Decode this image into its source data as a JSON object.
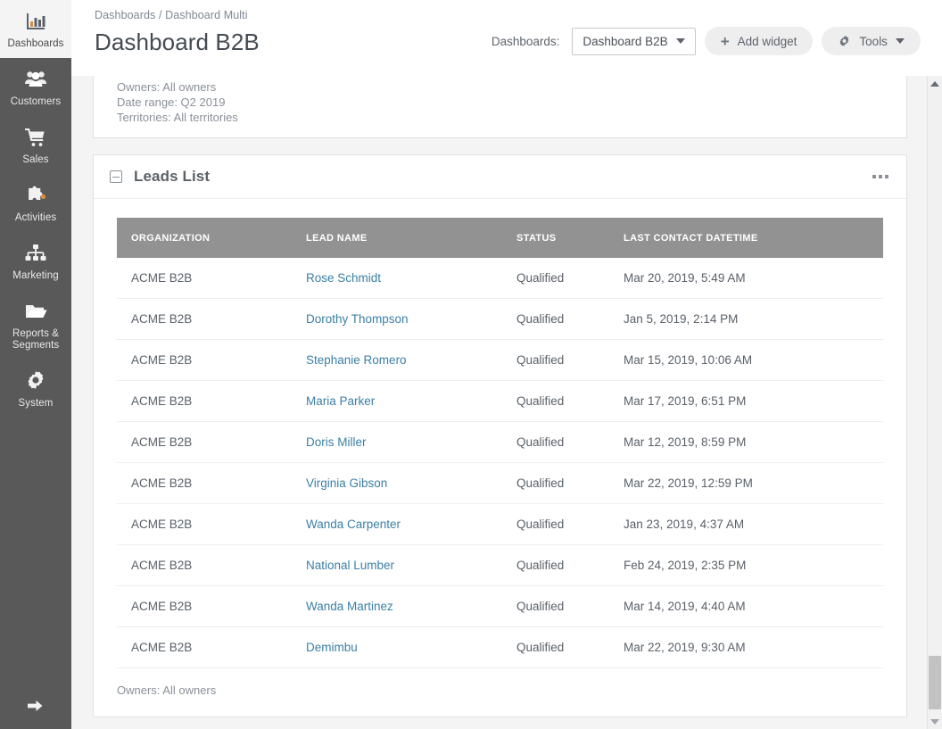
{
  "sidebar": {
    "items": [
      {
        "label": "Dashboards",
        "icon": "bar-chart-icon",
        "active": true
      },
      {
        "label": "Customers",
        "icon": "people-icon",
        "active": false
      },
      {
        "label": "Sales",
        "icon": "shopping-cart-icon",
        "active": false
      },
      {
        "label": "Activities",
        "icon": "puzzle-piece-icon",
        "active": false
      },
      {
        "label": "Marketing",
        "icon": "sitemap-icon",
        "active": false
      },
      {
        "label": "Reports &\nSegments",
        "icon": "folder-open-icon",
        "active": false
      },
      {
        "label": "System",
        "icon": "gear-icon",
        "active": false
      }
    ],
    "expand_icon": "arrow-right-icon"
  },
  "header": {
    "breadcrumb": "Dashboards / Dashboard Multi",
    "title": "Dashboard B2B",
    "dashboards_label": "Dashboards:",
    "dashboard_select_value": "Dashboard B2B",
    "add_widget_label": "Add widget",
    "tools_label": "Tools"
  },
  "filters_widget": {
    "owners": "Owners: All owners",
    "date_range": "Date range: Q2 2019",
    "territories": "Territories: All territories"
  },
  "leads_widget": {
    "title": "Leads List",
    "menu_icon": "ellipsis-icon",
    "collapse_icon": "minus-square-icon",
    "columns": [
      "ORGANIZATION",
      "LEAD NAME",
      "STATUS",
      "LAST CONTACT DATETIME"
    ],
    "rows": [
      {
        "organization": "ACME B2B",
        "lead_name": "Rose Schmidt",
        "status": "Qualified",
        "last_contact": "Mar 20, 2019, 5:49 AM"
      },
      {
        "organization": "ACME B2B",
        "lead_name": "Dorothy Thompson",
        "status": "Qualified",
        "last_contact": "Jan 5, 2019, 2:14 PM"
      },
      {
        "organization": "ACME B2B",
        "lead_name": "Stephanie Romero",
        "status": "Qualified",
        "last_contact": "Mar 15, 2019, 10:06 AM"
      },
      {
        "organization": "ACME B2B",
        "lead_name": "Maria Parker",
        "status": "Qualified",
        "last_contact": "Mar 17, 2019, 6:51 PM"
      },
      {
        "organization": "ACME B2B",
        "lead_name": "Doris Miller",
        "status": "Qualified",
        "last_contact": "Mar 12, 2019, 8:59 PM"
      },
      {
        "organization": "ACME B2B",
        "lead_name": "Virginia Gibson",
        "status": "Qualified",
        "last_contact": "Mar 22, 2019, 12:59 PM"
      },
      {
        "organization": "ACME B2B",
        "lead_name": "Wanda Carpenter",
        "status": "Qualified",
        "last_contact": "Jan 23, 2019, 4:37 AM"
      },
      {
        "organization": "ACME B2B",
        "lead_name": "National Lumber",
        "status": "Qualified",
        "last_contact": "Feb 24, 2019, 2:35 PM"
      },
      {
        "organization": "ACME B2B",
        "lead_name": "Wanda Martinez",
        "status": "Qualified",
        "last_contact": "Mar 14, 2019, 4:40 AM"
      },
      {
        "organization": "ACME B2B",
        "lead_name": "Demimbu",
        "status": "Qualified",
        "last_contact": "Mar 22, 2019, 9:30 AM"
      }
    ],
    "footer": "Owners: All owners"
  },
  "scrollbar": {
    "up_icon": "caret-up-icon",
    "down_icon": "caret-down-icon"
  },
  "colors": {
    "sidebar_bg": "#595959",
    "link": "#3b7fa6",
    "table_header_bg": "#929292",
    "page_bg": "#f4f4f4",
    "title_text": "#444b52"
  }
}
